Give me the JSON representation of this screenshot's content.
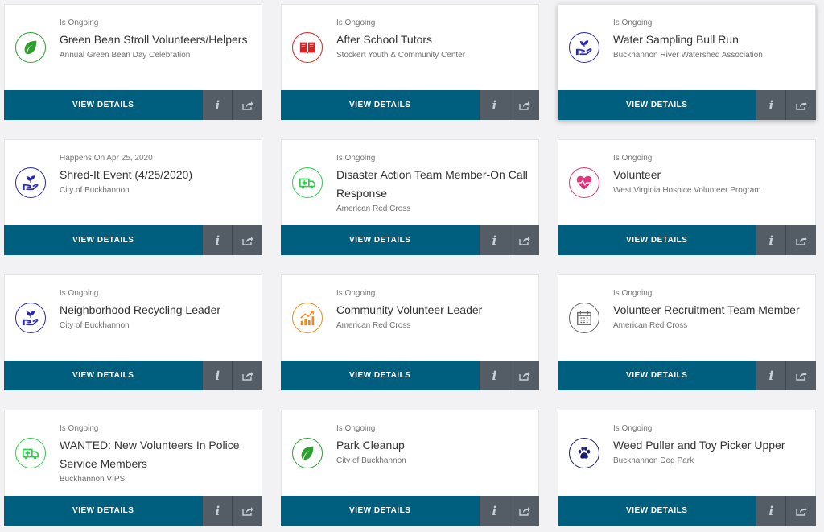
{
  "labels": {
    "view_details": "VIEW DETAILS",
    "info": "i"
  },
  "cards": [
    {
      "status": "Is Ongoing",
      "title": "Green Bean Stroll Volunteers/Helpers",
      "org": "Annual Green Bean Day Celebration",
      "icon": "leaf-icon",
      "color": "#2e9e2e"
    },
    {
      "status": "Is Ongoing",
      "title": "After School Tutors",
      "org": "Stockert Youth & Community Center",
      "icon": "book-icon",
      "color": "#e02020"
    },
    {
      "status": "Is Ongoing",
      "title": "Water Sampling Bull Run",
      "org": "Buckhannon River Watershed Association",
      "icon": "hand-plant-icon",
      "color": "#2a2aa8"
    },
    {
      "status": "Happens On Apr 25, 2020",
      "title": "Shred-It Event (4/25/2020)",
      "org": "City of Buckhannon",
      "icon": "hand-plant-icon",
      "color": "#2a2aa8"
    },
    {
      "status": "Is Ongoing",
      "title": "Disaster Action Team Member-On Call Response",
      "org": "American Red Cross",
      "icon": "ambulance-icon",
      "color": "#2ecf4a"
    },
    {
      "status": "Is Ongoing",
      "title": "Volunteer",
      "org": "West Virginia Hospice Volunteer Program",
      "icon": "heart-pulse-icon",
      "color": "#e0357a"
    },
    {
      "status": "Is Ongoing",
      "title": "Neighborhood Recycling Leader",
      "org": "City of Buckhannon",
      "icon": "hand-plant-icon",
      "color": "#2a2aa8"
    },
    {
      "status": "Is Ongoing",
      "title": "Community Volunteer Leader",
      "org": "American Red Cross",
      "icon": "chart-growth-icon",
      "color": "#f08a1c"
    },
    {
      "status": "Is Ongoing",
      "title": "Volunteer Recruitment Team Member",
      "org": "American Red Cross",
      "icon": "calendar-icon",
      "color": "#666666"
    },
    {
      "status": "Is Ongoing",
      "title": "WANTED: New Volunteers In Police Service Members",
      "org": "Buckhannon VIPS",
      "icon": "ambulance-icon",
      "color": "#2ecf4a"
    },
    {
      "status": "Is Ongoing",
      "title": "Park Cleanup",
      "org": "City of Buckhannon",
      "icon": "leaf-icon",
      "color": "#2e9e2e"
    },
    {
      "status": "Is Ongoing",
      "title": "Weed Puller and Toy Picker Upper",
      "org": "Buckhannon Dog Park",
      "icon": "paw-icon",
      "color": "#1d1d6e"
    }
  ]
}
